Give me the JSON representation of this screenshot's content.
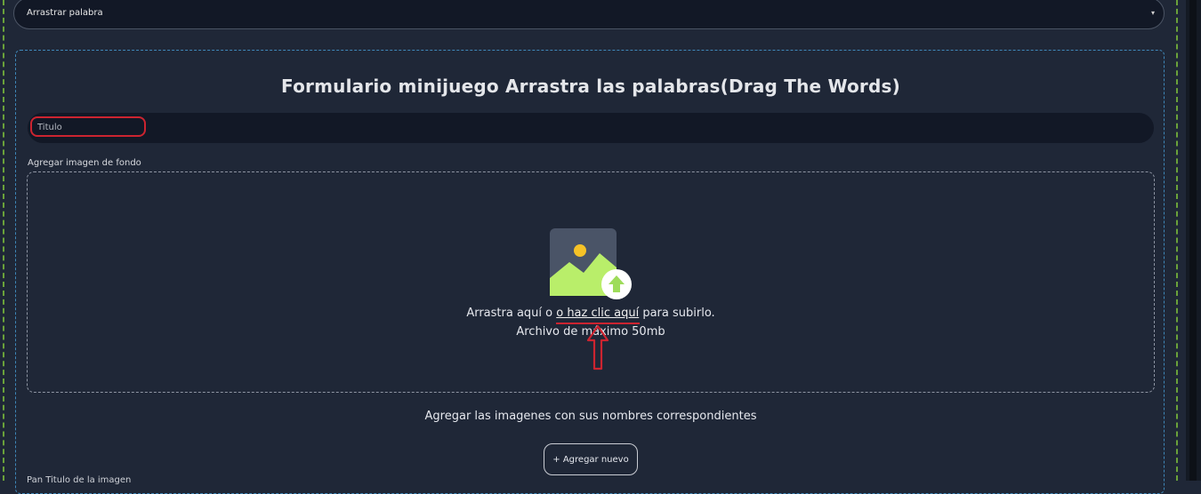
{
  "game_select": {
    "value": "Arrastrar palabra",
    "caret": "▾"
  },
  "form": {
    "title": "Formulario minijuego Arrastra las palabras(Drag The Words)",
    "title_input_placeholder": "Titulo",
    "background_label": "Agregar imagen de fondo",
    "dropzone": {
      "text_before": "Arrastra aquí o ",
      "link": "o haz clic aquí",
      "text_after": " para subirlo.",
      "limit": "Archivo de máximo 50mb"
    },
    "images_heading": "Agregar las imagenes con sus nombres correspondientes",
    "add_button": "+ Agregar nuevo",
    "cut_off_text": "Pan Titulo de la imagen"
  },
  "colors": {
    "background": "#1f2737",
    "input_bg": "#121826",
    "annotation_red": "#cc2430",
    "icon_green": "#b9ee6a",
    "card_border": "#3f87b8"
  },
  "icons": [
    "image-upload-icon",
    "upload-arrow-icon",
    "caret-down-icon",
    "annotation-arrow-icon"
  ]
}
